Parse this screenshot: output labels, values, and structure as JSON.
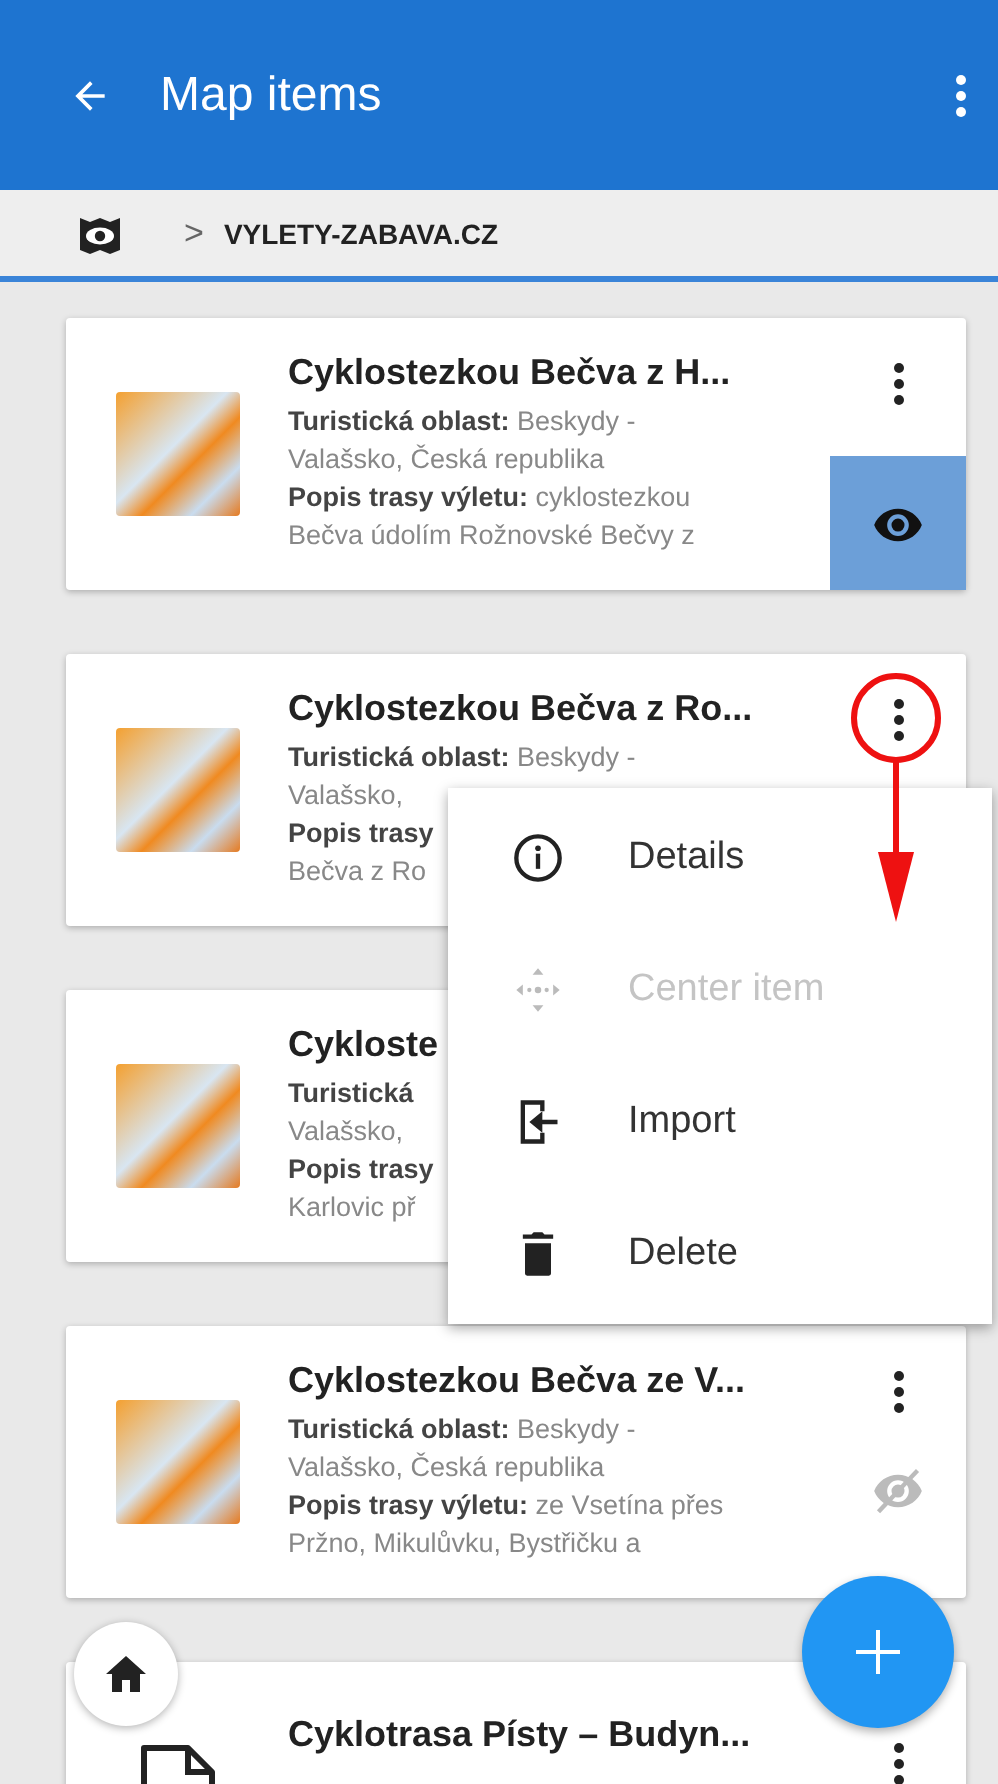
{
  "app_bar": {
    "title": "Map items"
  },
  "breadcrumb": {
    "separator": ">",
    "path": "VYLETY-ZABAVA.CZ"
  },
  "items": [
    {
      "kind": "photo",
      "title": "Cyklostezkou Bečva z H...",
      "visible": true,
      "lines": [
        "**Turistická oblast:** Beskydy -",
        "Valašsko, Česká republika",
        "**Popis trasy výletu:** cyklostezkou",
        "Bečva údolím Rožnovské Bečvy z"
      ]
    },
    {
      "kind": "photo",
      "title": "Cyklostezkou Bečva z Ro...",
      "lines": [
        "**Turistická oblast:** Beskydy -",
        "Valašsko,",
        "**Popis trasy**",
        "Bečva z Ro"
      ]
    },
    {
      "kind": "photo",
      "title": "Cykloste",
      "lines": [
        "**Turistická**",
        "Valašsko,",
        "**Popis trasy**",
        "Karlovic př"
      ]
    },
    {
      "kind": "photo",
      "title": "Cyklostezkou Bečva ze V...",
      "visible": false,
      "lines": [
        "**Turistická oblast:** Beskydy -",
        "Valašsko, Česká republika",
        "**Popis trasy výletu:** ze Vsetína přes",
        "Pržno, Mikulůvku, Bystřičku a"
      ]
    },
    {
      "kind": "document",
      "title": "Cyklotrasa Písty – Budyn..."
    }
  ],
  "context_menu": {
    "items": [
      {
        "label": "Details",
        "disabled": false
      },
      {
        "label": "Center item",
        "disabled": true
      },
      {
        "label": "Import",
        "disabled": false
      },
      {
        "label": "Delete",
        "disabled": false
      }
    ]
  }
}
